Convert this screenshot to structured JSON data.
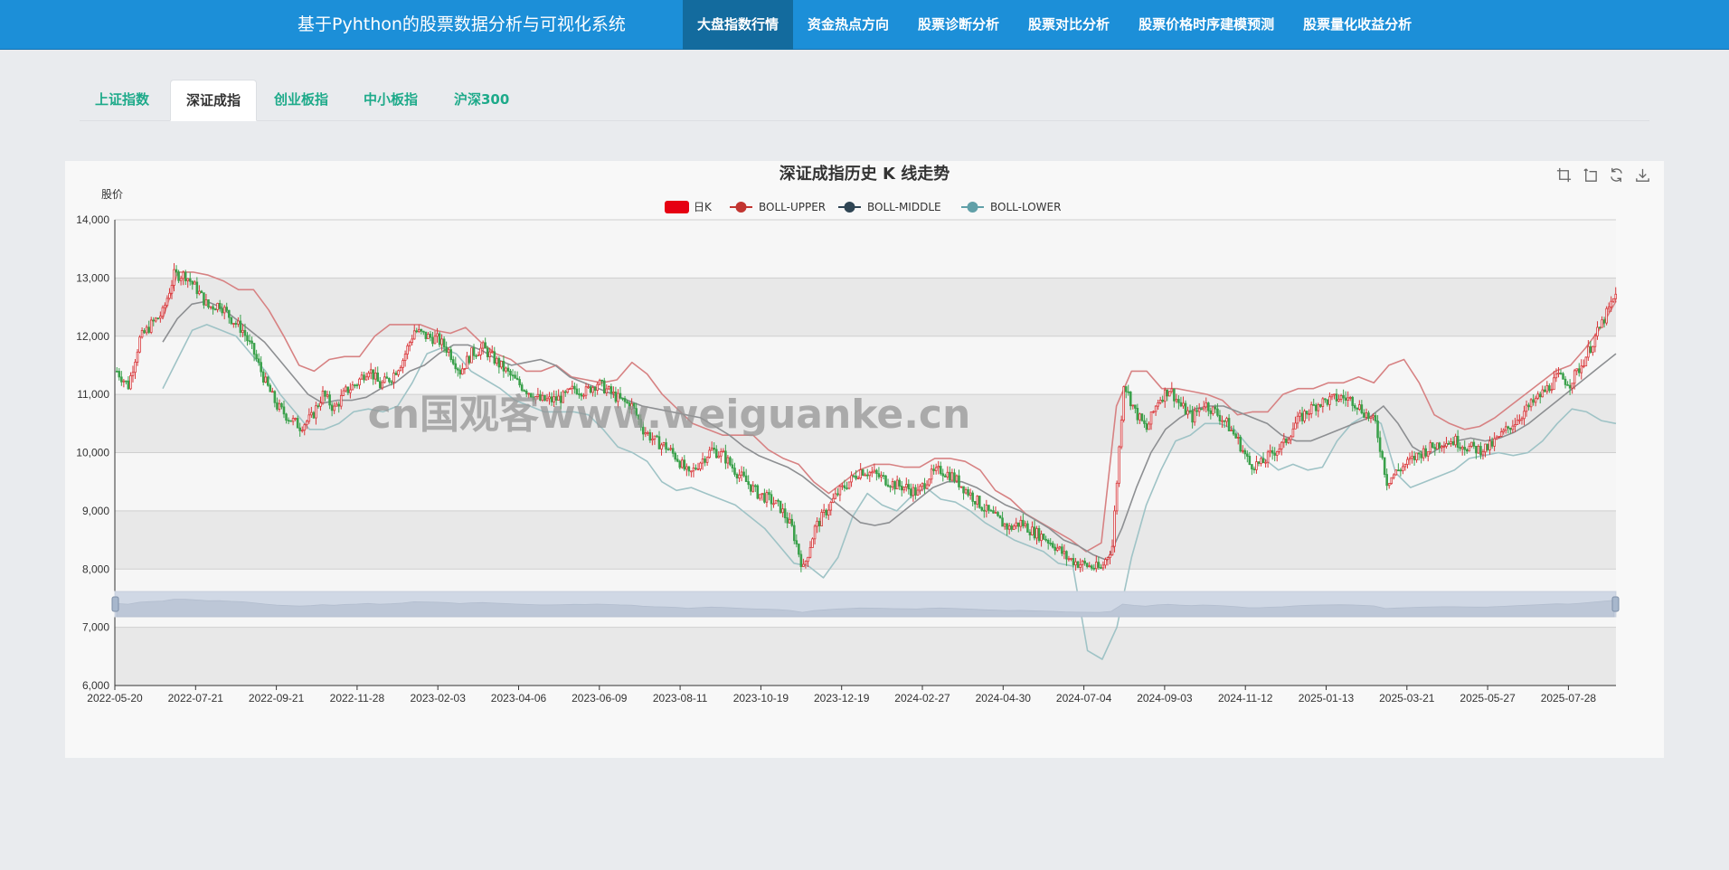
{
  "header": {
    "app_title": "基于Pyhthon的股票数据分析与可视化系统",
    "nav": [
      {
        "label": "大盘指数行情",
        "active": true
      },
      {
        "label": "资金热点方向",
        "active": false
      },
      {
        "label": "股票诊断分析",
        "active": false
      },
      {
        "label": "股票对比分析",
        "active": false
      },
      {
        "label": "股票价格时序建模预测",
        "active": false
      },
      {
        "label": "股票量化收益分析",
        "active": false
      }
    ]
  },
  "tabs": [
    {
      "label": "上证指数",
      "active": false
    },
    {
      "label": "深证成指",
      "active": true
    },
    {
      "label": "创业板指",
      "active": false
    },
    {
      "label": "中小板指",
      "active": false
    },
    {
      "label": "沪深300",
      "active": false
    }
  ],
  "watermark": "cn国观客www.weiguanke.cn",
  "toolbox": [
    "zoom-icon",
    "zoom-reset-icon",
    "restore-icon",
    "save-image-icon"
  ],
  "chart_data": {
    "type": "candlestick",
    "title": "深证成指历史 K 线走势",
    "ylabel": "股价",
    "ylim": [
      6000,
      14000
    ],
    "yticks": [
      "6,000",
      "7,000",
      "8,000",
      "9,000",
      "10,000",
      "11,000",
      "12,000",
      "13,000",
      "14,000"
    ],
    "xticks": [
      "2022-05-20",
      "2022-07-21",
      "2022-09-21",
      "2022-11-28",
      "2023-02-03",
      "2023-04-06",
      "2023-06-09",
      "2023-08-11",
      "2023-10-19",
      "2023-12-19",
      "2024-02-27",
      "2024-04-30",
      "2024-07-04",
      "2024-09-03",
      "2024-11-12",
      "2025-01-13",
      "2025-03-21",
      "2025-05-27",
      "2025-07-28"
    ],
    "grid": "banded",
    "legend_position": "top-center",
    "legend": [
      {
        "name": "日K",
        "color": "#e60012",
        "shape": "rect"
      },
      {
        "name": "BOLL-UPPER",
        "color": "#c23531",
        "shape": "circle"
      },
      {
        "name": "BOLL-MIDDLE",
        "color": "#2f4554",
        "shape": "circle"
      },
      {
        "name": "BOLL-LOWER",
        "color": "#61a0a8",
        "shape": "circle"
      }
    ],
    "colors": {
      "up": "#d9373a",
      "down": "#3aa14b",
      "upper": "#d78283",
      "middle": "#8d8f92",
      "lower": "#9fc3c6"
    },
    "series": [
      {
        "name": "日K",
        "values": [
          11400,
          11150,
          11950,
          12200,
          12400,
          13050,
          13050,
          12800,
          12500,
          12550,
          12300,
          12100,
          11700,
          11200,
          10800,
          10600,
          10450,
          10600,
          11000,
          10750,
          11050,
          11200,
          11450,
          11150,
          11300,
          11600,
          12100,
          12000,
          11950,
          11750,
          11400,
          11700,
          11800,
          11600,
          11400,
          11200,
          11050,
          10900,
          10900,
          10950,
          11100,
          11050,
          11200,
          11050,
          10900,
          10800,
          10400,
          10200,
          10100,
          9900,
          9600,
          9850,
          10050,
          9950,
          9700,
          9500,
          9300,
          9200,
          9050,
          8700,
          8000,
          8700,
          9000,
          9300,
          9500,
          9700,
          9650,
          9550,
          9450,
          9400,
          9300,
          9600,
          9700,
          9600,
          9400,
          9200,
          9000,
          8850,
          8700,
          8800,
          8650,
          8550,
          8400,
          8200,
          8100,
          8050,
          8000,
          8400,
          11200,
          10700,
          10400,
          10900,
          11100,
          10800,
          10600,
          10850,
          10700,
          10500,
          10200,
          9800,
          9800,
          10000,
          10150,
          10500,
          10700,
          10850,
          10900,
          10950,
          10900,
          10700,
          10500,
          9500,
          9700,
          9850,
          10000,
          10100,
          10200,
          10200,
          10100,
          10050,
          10100,
          10300,
          10500,
          10700,
          10900,
          11100,
          11300,
          11200,
          11500,
          11900,
          12300,
          12700
        ]
      },
      {
        "name": "BOLL-UPPER",
        "values": [
          12300,
          13100,
          13100,
          13050,
          12950,
          12800,
          12800,
          12450,
          12000,
          11500,
          11400,
          11600,
          11650,
          11650,
          12000,
          12200,
          12200,
          12200,
          12100,
          12050,
          12150,
          11900,
          11700,
          11600,
          11400,
          11400,
          11500,
          11300,
          11250,
          11200,
          11250,
          11550,
          11350,
          11000,
          10750,
          10500,
          10400,
          10300,
          10300,
          10300,
          10050,
          9900,
          9800,
          9500,
          9300,
          9500,
          9700,
          9800,
          9800,
          9750,
          9750,
          9900,
          9900,
          9850,
          9700,
          9350,
          9200,
          8950,
          8800,
          8650,
          8500,
          8300,
          8450,
          10800,
          11400,
          11400,
          11100,
          11100,
          11050,
          11000,
          10900,
          10650,
          10700,
          10700,
          11000,
          11100,
          11100,
          11200,
          11200,
          11300,
          11200,
          11500,
          11600,
          11200,
          10650,
          10500,
          10400,
          10450,
          10600,
          10800,
          11000,
          11200,
          11400,
          11500,
          11800,
          12150,
          12600
        ]
      },
      {
        "name": "BOLL-MIDDLE",
        "values": [
          11900,
          12300,
          12550,
          12600,
          12500,
          12300,
          12100,
          11900,
          11600,
          11300,
          11000,
          10850,
          10900,
          10900,
          10950,
          11100,
          11200,
          11400,
          11500,
          11700,
          11850,
          11850,
          11750,
          11600,
          11500,
          11550,
          11600,
          11500,
          11300,
          11200,
          11100,
          11000,
          10900,
          10800,
          10750,
          10700,
          10650,
          10600,
          10450,
          10300,
          10100,
          9950,
          9850,
          9750,
          9600,
          9400,
          9200,
          9000,
          8800,
          8750,
          8800,
          9000,
          9200,
          9400,
          9500,
          9500,
          9400,
          9250,
          9100,
          9000,
          8850,
          8700,
          8500,
          8400,
          8250,
          8150,
          8700,
          9400,
          10000,
          10400,
          10600,
          10750,
          10800,
          10800,
          10700,
          10600,
          10500,
          10300,
          10200,
          10200,
          10300,
          10400,
          10500,
          10600,
          10800,
          10500,
          10100,
          9950,
          10100,
          10200,
          10250,
          10200,
          10250,
          10350,
          10500,
          10700,
          10900,
          11100,
          11300,
          11500,
          11700
        ]
      },
      {
        "name": "BOLL-LOWER",
        "values": [
          11100,
          11600,
          12100,
          12200,
          12100,
          12000,
          11700,
          11400,
          11000,
          10700,
          10400,
          10400,
          10500,
          10700,
          10750,
          10700,
          10800,
          11200,
          11700,
          11800,
          11700,
          11400,
          11250,
          11100,
          10900,
          10800,
          10700,
          10700,
          10700,
          10650,
          10400,
          10100,
          10000,
          9850,
          9500,
          9350,
          9400,
          9300,
          9200,
          9100,
          8900,
          8700,
          8400,
          8100,
          8050,
          7850,
          8200,
          8900,
          9300,
          9100,
          9000,
          9250,
          9400,
          9200,
          9150,
          9000,
          8800,
          8650,
          8500,
          8400,
          8300,
          8100,
          8050,
          6600,
          6450,
          7000,
          8200,
          9100,
          9700,
          10200,
          10300,
          10500,
          10500,
          10400,
          10100,
          9900,
          9700,
          9800,
          9700,
          9750,
          10200,
          10500,
          10650,
          10500,
          9650,
          9400,
          9500,
          9600,
          9700,
          9900,
          9950,
          10000,
          9950,
          10000,
          10200,
          10500,
          10750,
          10700,
          10550,
          10500
        ]
      }
    ]
  }
}
